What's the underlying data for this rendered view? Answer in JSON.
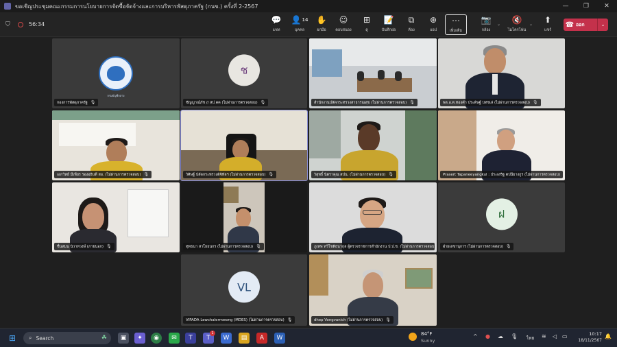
{
  "window": {
    "title": "ขอเชิญประชุมคณะกรรมการนโยบายการจัดซื้อจัดจ้างและการบริหารพัสดุภาครัฐ (กนข.) ครั้งที่ 2-2567",
    "minimize": "—",
    "maximize": "❐",
    "close": "✕"
  },
  "toolbar": {
    "timer": "56:34",
    "items": [
      {
        "label": "แชท",
        "icon": "💬"
      },
      {
        "label": "บุคคล",
        "icon": "👤",
        "count": "14"
      },
      {
        "label": "ยกมือ",
        "icon": "✋"
      },
      {
        "label": "ตอบสนอง",
        "icon": "☺"
      },
      {
        "label": "ดู",
        "icon": "⊞"
      },
      {
        "label": "บันทึกย่อ",
        "icon": "📝"
      },
      {
        "label": "ห้อง",
        "icon": "⧉"
      },
      {
        "label": "แอป",
        "icon": "⊕"
      },
      {
        "label": "เพิ่มเติม",
        "icon": "⋯"
      },
      {
        "label": "กล้อง",
        "icon": "📷"
      },
      {
        "label": "ไมโครโฟน",
        "icon": "🔇"
      },
      {
        "label": "แชร์",
        "icon": "⬆"
      }
    ],
    "leave_label": "ออก"
  },
  "tiles": [
    {
      "name": "กองการพัสดุภาครัฐ",
      "logo_text": "กรมบัญชีกลาง"
    },
    {
      "name": "ชัญญาณ์ภัช // สป.คค (ไม่ผ่านการตรวจสอบ)",
      "initial": "ช"
    },
    {
      "name": "สำนักงานปลัดกระทรวงสาธารณสุข (ไม่ผ่านการตรวจสอบ)"
    },
    {
      "name": "พล.อ.ต.ทองคำ ประดิษฐ์ บทชเล่ (ไม่ผ่านการตรวจสอบ)"
    },
    {
      "name": "เอกวิทย์ มีเพียร รองอธิบดี สอ. (ไม่ผ่านการตรวจสอบ)"
    },
    {
      "name": "วิศิษฐ์ ปลัดกระทรวงดิจิทัลฯ (ไม่ผ่านการตรวจสอบ)"
    },
    {
      "name": "วิสุทธิ์ นิตราคุณ สปน. (ไม่ผ่านการตรวจสอบ)"
    },
    {
      "name": "Prasert Tapaneeyangkul : ประเสริฐ ตปนียางกูร (ไม่ผ่านการตรวจสอบ)"
    },
    {
      "name": "ชื่นสมน นิวาทวงษ์ (ภายนอก)"
    },
    {
      "name": "ทุทธนา สาโยธนกร (ไม่ผ่านการตรวจสอบ)"
    },
    {
      "name": "ภูเทพ ทวีโชติธนากุล ผู้ตรวจราชการสำนักงาน ป.ป.ช. (ไม่ผ่านการตรวจสอบ)"
    },
    {
      "name": "ฝ่ายเลขานุการ (ไม่ผ่านการตรวจสอบ)",
      "initial": "ฝ"
    },
    {
      "name": "VIPADA Lewchalermwong (MDES) (ไม่ผ่านการตรวจสอบ)",
      "initial": "VL"
    },
    {
      "name": "dhep Vongvanich (ไม่ผ่านการตรวจสอบ)"
    }
  ],
  "taskbar": {
    "search_placeholder": "Search",
    "weather_temp": "84°F",
    "weather_desc": "Sunny",
    "language": "ไทย",
    "time": "10:17",
    "date": "18/11/2567",
    "teams_badge": "1"
  },
  "colors": {
    "leave": "#c4314b",
    "active_tile": "#8a8fd6",
    "avatar_bg": "#e8e6e1"
  }
}
